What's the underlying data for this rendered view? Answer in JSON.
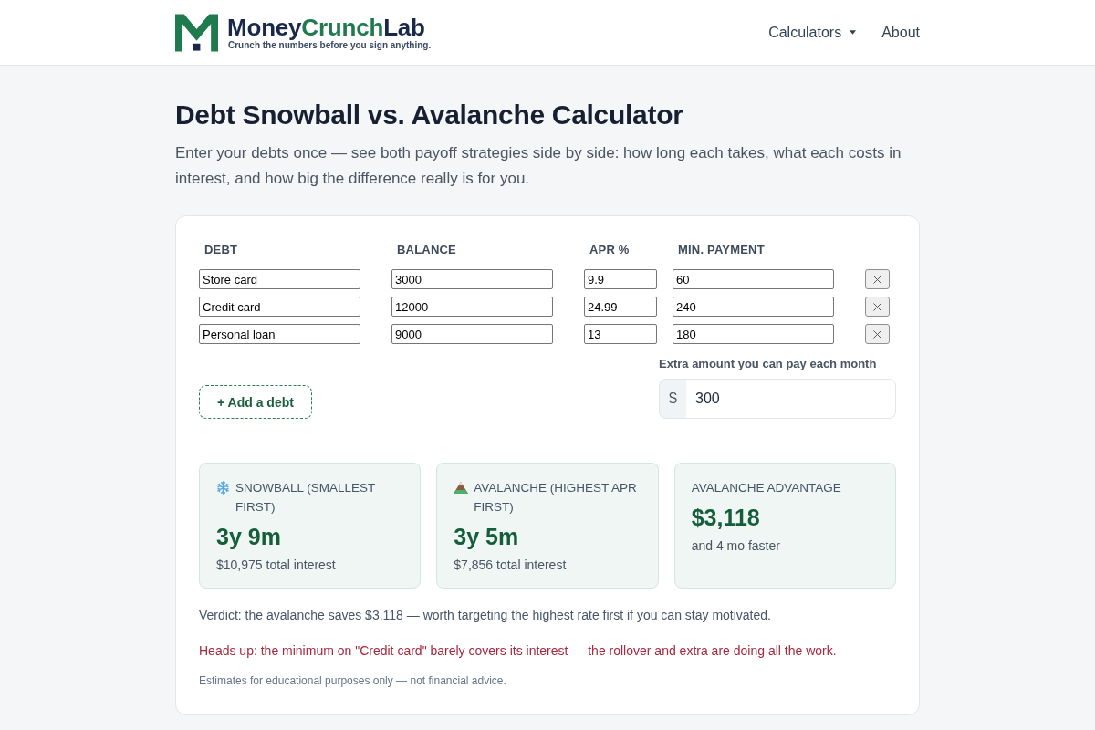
{
  "header": {
    "brand": [
      {
        "text": "Money",
        "kind": "plain"
      },
      {
        "text": "Crunch",
        "kind": "accent"
      },
      {
        "text": "Lab",
        "kind": "plain"
      }
    ],
    "tagline": "Crunch the numbers before you sign anything.",
    "nav": [
      {
        "label": "Calculators",
        "kind": "dropdown"
      },
      {
        "label": "About",
        "kind": "link"
      }
    ]
  },
  "page": {
    "title": "Debt Snowball vs. Avalanche Calculator",
    "intro": "Enter your debts once — see both payoff strategies side by side: how long each takes, what each costs in interest, and how big the difference really is for you."
  },
  "debts": {
    "columns": [
      "DEBT",
      "BALANCE",
      "APR %",
      "MIN. PAYMENT"
    ],
    "rows": [
      {
        "name": "Store card",
        "balance": "3000",
        "apr": "9.9",
        "min_payment": "60"
      },
      {
        "name": "Credit card",
        "balance": "12000",
        "apr": "24.99",
        "min_payment": "240"
      },
      {
        "name": "Personal loan",
        "balance": "9000",
        "apr": "13",
        "min_payment": "180"
      }
    ],
    "add_button": "+ Add a debt"
  },
  "extra": {
    "label": "Extra amount you can pay each month",
    "prefix": "$",
    "value": "300"
  },
  "results": [
    {
      "kind": "snowball",
      "label": "SNOWBALL (SMALLEST FIRST)",
      "value": "3y 9m",
      "detail": "$10,975 total interest"
    },
    {
      "kind": "avalanche",
      "label": "AVALANCHE (HIGHEST APR FIRST)",
      "value": "3y 5m",
      "detail": "$7,856 total interest"
    },
    {
      "kind": "advantage",
      "label": "AVALANCHE ADVANTAGE",
      "value": "$3,118",
      "detail": "and 4 mo faster"
    }
  ],
  "messages": [
    {
      "kind": "verdict",
      "text": "Verdict: the avalanche saves $3,118 — worth targeting the highest rate first if you can stay motivated."
    },
    {
      "kind": "warning",
      "text": "Heads up: the minimum on \"Credit card\" barely covers its interest — the rollover and extra are doing all the work."
    }
  ],
  "disclaimer": "Estimates for educational purposes only — not financial advice."
}
